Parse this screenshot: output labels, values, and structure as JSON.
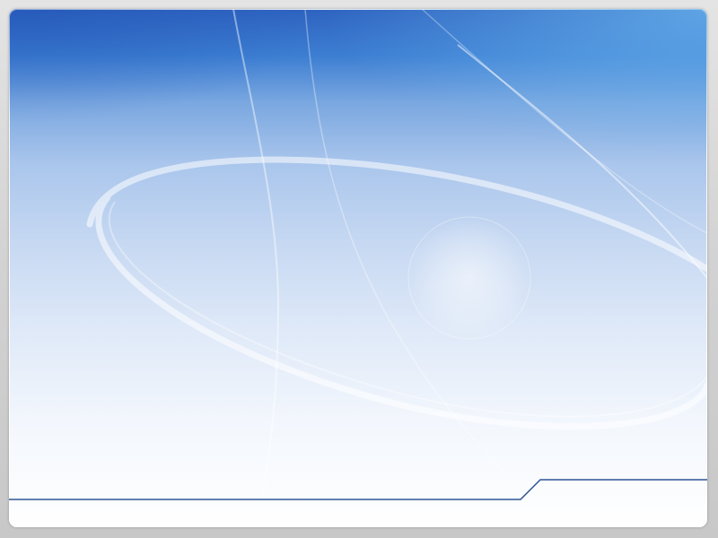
{
  "theme": {
    "frame_color": "#d6d6d6",
    "gradient_top": "#2e63c0",
    "gradient_bottom": "#ffffff",
    "accent_line": "#2f5597"
  }
}
